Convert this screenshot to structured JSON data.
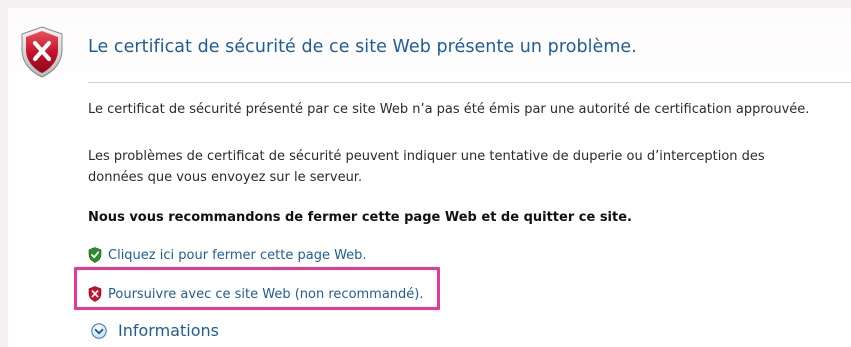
{
  "header": {
    "title": "Le certificat de sécurité de ce site Web présente un problème.",
    "icon": "shield-error-icon"
  },
  "body": {
    "paragraph_1": "Le certificat de sécurité présenté par ce site Web n’a pas été émis par une autorité de certification approuvée.",
    "paragraph_2_line_1": "Les problèmes de certificat de sécurité peuvent indiquer une tentative de duperie ou d’interception des",
    "paragraph_2_line_2": "données que vous envoyez sur le serveur.",
    "recommendation": "Nous vous recommandons de fermer cette page Web et de quitter ce site."
  },
  "links": {
    "close_page": "Cliquez ici pour fermer cette page Web.",
    "continue": "Poursuivre avec ce site Web (non recommandé).",
    "more_info": "Informations"
  },
  "colors": {
    "link": "#1f5d99",
    "highlight": "#e4399a",
    "error_red": "#c8102e",
    "safe_green": "#2e8b2e"
  }
}
